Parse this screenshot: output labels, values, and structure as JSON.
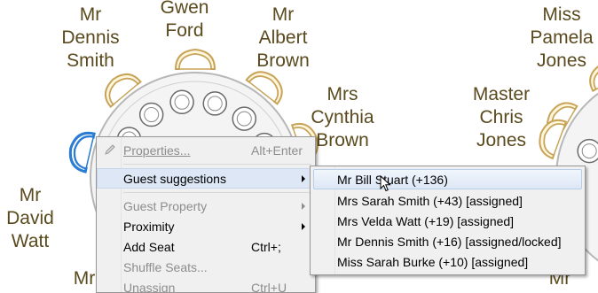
{
  "guests": [
    {
      "name": "Mr\nDennis\nSmith"
    },
    {
      "name": "Gwen\nFord"
    },
    {
      "name": "Mr\nAlbert\nBrown"
    },
    {
      "name": "Mrs\nCynthia\nBrown"
    },
    {
      "name": "Mr\nDavid\nWatt"
    },
    {
      "name": "Mr"
    },
    {
      "name": "Miss\nPamela\nJones"
    },
    {
      "name": "Master\nChris\nJones"
    },
    {
      "name": "Mr"
    }
  ],
  "context_menu": {
    "items": [
      {
        "label": "Properties...",
        "shortcut": "Alt+Enter",
        "disabled": true
      },
      {
        "label": "Guest suggestions",
        "submenu": true,
        "highlighted": true
      },
      {
        "label": "Guest Property",
        "submenu": true,
        "disabled": true
      },
      {
        "label": "Proximity",
        "submenu": true
      },
      {
        "label": "Add Seat",
        "shortcut": "Ctrl+;"
      },
      {
        "label": "Shuffle Seats...",
        "disabled": true
      },
      {
        "label": "Unassign",
        "shortcut": "Ctrl+U",
        "disabled": true
      }
    ]
  },
  "suggestions_menu": {
    "items": [
      {
        "label": "Mr Bill Stuart (+136)",
        "highlighted": true
      },
      {
        "label": "Mrs Sarah Smith (+43) [assigned]"
      },
      {
        "label": "Mrs Velda Watt (+19) [assigned]"
      },
      {
        "label": "Mr Dennis Smith (+16) [assigned/locked]"
      },
      {
        "label": "Miss Sarah Burke (+10) [assigned]"
      }
    ]
  },
  "colors": {
    "guest_text": "#5a4a1e",
    "chair_fill": "#fff6dc",
    "chair_stroke": "#c8a45a",
    "selected_chair": "#2b7cd3",
    "table_fill": "#f4f4f4"
  }
}
